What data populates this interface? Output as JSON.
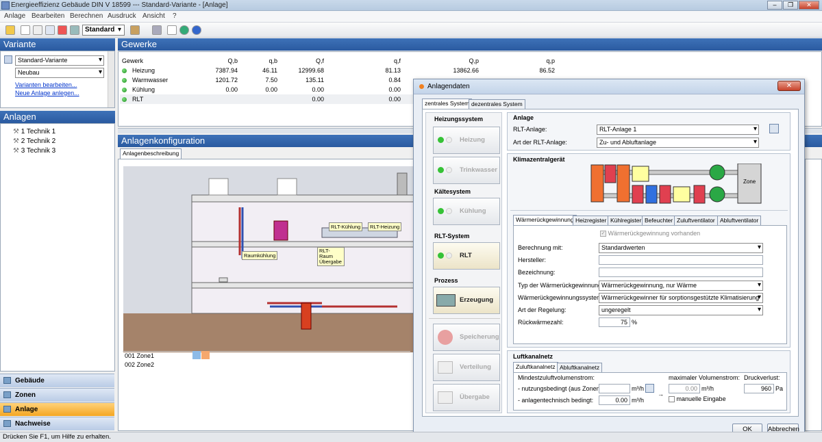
{
  "window": {
    "title": "Energieeffizienz Gebäude DIN V 18599 --- Standard-Variante - [Anlage]"
  },
  "menu": [
    "Anlage",
    "Bearbeiten",
    "Berechnen",
    "Ausdruck",
    "Ansicht",
    "?"
  ],
  "toolbar": {
    "profile": "Standard"
  },
  "variante": {
    "header": "Variante",
    "selected": "Standard-Variante",
    "type": "Neubau",
    "links": [
      "Varianten bearbeiten...",
      "Neue Anlage anlegen..."
    ]
  },
  "anlagen": {
    "header": "Anlagen",
    "items": [
      "1 Technik 1",
      "2 Technik 2",
      "3 Technik 3"
    ]
  },
  "nav": [
    "Gebäude",
    "Zonen",
    "Anlage",
    "Nachweise"
  ],
  "gewerke": {
    "header": "Gewerke",
    "columns": [
      "Gewerk",
      "Q,b",
      "q,b",
      "Q,f",
      "q,f",
      "Q,p",
      "q,p"
    ],
    "rows": [
      [
        "Heizung",
        "7387.94",
        "46.11",
        "12999.68",
        "81.13",
        "13862.66",
        "86.52"
      ],
      [
        "Warmwasser",
        "1201.72",
        "7.50",
        "135.11",
        "0.84",
        "",
        ""
      ],
      [
        "Kühlung",
        "0.00",
        "0.00",
        "0.00",
        "0.00",
        "",
        ""
      ],
      [
        "RLT",
        "",
        "",
        "0.00",
        "0.00",
        "",
        ""
      ]
    ]
  },
  "config": {
    "header": "Anlagenkonfiguration",
    "tab": "Anlagenbeschreibung",
    "labels": [
      "RLT-Kühlung",
      "RLT-Heizung",
      "Raumkühlung",
      "RLT-Raum Übergabe"
    ],
    "zones": [
      "001 Zone1",
      "002 Zone2"
    ]
  },
  "dialog": {
    "title": "Anlagendaten",
    "tabs": [
      "zentrales System",
      "dezentrales System"
    ],
    "left": {
      "heizungssystem": "Heizungssystem",
      "heizung": "Heizung",
      "trinkwasser": "Trinkwasser",
      "kaeltesystem": "Kältesystem",
      "kuehlung": "Kühlung",
      "rltsystem": "RLT-System",
      "rlt": "RLT",
      "prozess": "Prozess",
      "erzeugung": "Erzeugung",
      "speicherung": "Speicherung",
      "verteilung": "Verteilung",
      "uebergabe": "Übergabe"
    },
    "anlage": {
      "header": "Anlage",
      "rlt_anlage_label": "RLT-Anlage:",
      "rlt_anlage": "RLT-Anlage 1",
      "art_label": "Art der RLT-Anlage:",
      "art": "Zu- und Abluftanlage"
    },
    "klima": {
      "header": "Klimazentralgerät",
      "zone": "Zone"
    },
    "subtabs": [
      "Wärmerückgewinnung",
      "Heizregister",
      "Kühlregister",
      "Befeuchter",
      "Zuluftventilator",
      "Abluftventilator"
    ],
    "wrg": {
      "vorhanden": "Wärmerückgewinnung vorhanden",
      "berechnung_label": "Berechnung mit:",
      "berechnung": "Standardwerten",
      "hersteller_label": "Hersteller:",
      "bezeichnung_label": "Bezeichnung:",
      "typ_label": "Typ der Wärmerückgewinnung:",
      "typ": "Wärmerückgewinnung, nur Wärme",
      "system_label": "Wärmerückgewinnungssystem:",
      "system": "Wärmerückgewinner für sorptionsgestützte Klimatisierung",
      "regelung_label": "Art der Regelung:",
      "regelung": "ungeregelt",
      "rueck_label": "Rückwärmezahl:",
      "rueck": "75",
      "rueck_unit": "%"
    },
    "luft": {
      "header": "Luftkanalnetz",
      "tabs": [
        "Zuluftkanalnetz",
        "Abluftkanalnetz"
      ],
      "min_label": "Mindestzuluftvolumenstrom:",
      "nutz_label": "- nutzungsbedingt (aus Zonen):",
      "nutz": "",
      "anl_label": "- anlagentechnisch bedingt:",
      "anl": "0.00",
      "unit": "m³/h",
      "max_label": "maximaler Volumenstrom:",
      "max": "0.00",
      "manuell": "manuelle Eingabe",
      "druck_label": "Druckverlust:",
      "druck": "960",
      "druck_unit": "Pa"
    },
    "ok": "OK",
    "cancel": "Abbrechen"
  },
  "status": "Drücken Sie F1, um Hilfe zu erhalten."
}
